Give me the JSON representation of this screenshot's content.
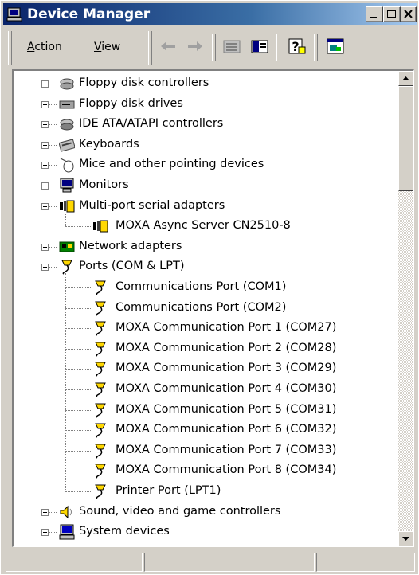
{
  "window": {
    "title": "Device Manager",
    "controls": {
      "minimize": "minimize",
      "maximize": "maximize",
      "close": "close"
    }
  },
  "menu": {
    "action": {
      "access": "A",
      "rest": "ction"
    },
    "view": {
      "access": "V",
      "rest": "iew"
    }
  },
  "toolbar": {
    "icons": [
      "back-arrow-icon",
      "forward-arrow-icon",
      "up-folder-icon",
      "show-hide-tree-icon",
      "help-icon",
      "properties-icon"
    ]
  },
  "tree": {
    "items": [
      {
        "label": "Floppy disk controllers",
        "icon": "floppy-controller-icon",
        "expander": "+"
      },
      {
        "label": "Floppy disk drives",
        "icon": "floppy-drive-icon",
        "expander": "+"
      },
      {
        "label": "IDE ATA/ATAPI controllers",
        "icon": "ide-controller-icon",
        "expander": "+"
      },
      {
        "label": "Keyboards",
        "icon": "keyboard-icon",
        "expander": "+"
      },
      {
        "label": "Mice and other pointing devices",
        "icon": "mouse-icon",
        "expander": "+"
      },
      {
        "label": "Monitors",
        "icon": "monitor-icon",
        "expander": "+"
      },
      {
        "label": "Multi-port serial adapters",
        "icon": "serial-adapter-icon",
        "expander": "-"
      },
      {
        "label": "MOXA Async Server CN2510-8",
        "icon": "serial-adapter-icon",
        "child": true
      },
      {
        "label": "Network adapters",
        "icon": "network-adapter-icon",
        "expander": "+"
      },
      {
        "label": "Ports (COM & LPT)",
        "icon": "port-icon",
        "expander": "-"
      },
      {
        "label": "Communications Port (COM1)",
        "icon": "port-icon",
        "child": true
      },
      {
        "label": "Communications Port (COM2)",
        "icon": "port-icon",
        "child": true
      },
      {
        "label": "MOXA Communication Port 1 (COM27)",
        "icon": "port-icon",
        "child": true
      },
      {
        "label": "MOXA Communication Port 2 (COM28)",
        "icon": "port-icon",
        "child": true
      },
      {
        "label": "MOXA Communication Port 3 (COM29)",
        "icon": "port-icon",
        "child": true
      },
      {
        "label": "MOXA Communication Port 4 (COM30)",
        "icon": "port-icon",
        "child": true
      },
      {
        "label": "MOXA Communication Port 5 (COM31)",
        "icon": "port-icon",
        "child": true
      },
      {
        "label": "MOXA Communication Port 6 (COM32)",
        "icon": "port-icon",
        "child": true
      },
      {
        "label": "MOXA Communication Port 7 (COM33)",
        "icon": "port-icon",
        "child": true
      },
      {
        "label": "MOXA Communication Port 8 (COM34)",
        "icon": "port-icon",
        "child": true
      },
      {
        "label": "Printer Port (LPT1)",
        "icon": "port-icon",
        "child": true
      },
      {
        "label": "Sound, video and game controllers",
        "icon": "sound-icon",
        "expander": "+"
      },
      {
        "label": "System devices",
        "icon": "system-devices-icon",
        "expander": "+"
      }
    ]
  },
  "colors": {
    "titlebar_start": "#0a246a",
    "titlebar_end": "#a6caf0",
    "face": "#d4d0c8"
  }
}
